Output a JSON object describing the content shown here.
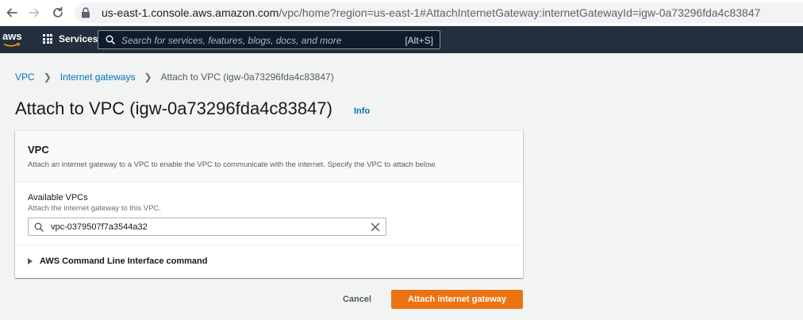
{
  "browser": {
    "url_host": "us-east-1.console.aws.amazon.com",
    "url_path": "/vpc/home?region=us-east-1#AttachInternetGateway:internetGatewayId=igw-0a73296fda4c83847",
    "icons": [
      "back-arrow-icon",
      "forward-arrow-icon",
      "reload-icon",
      "lock-icon"
    ]
  },
  "topnav": {
    "logo_text": "aws",
    "services_label": "Services",
    "search_placeholder": "Search for services, features, blogs, docs, and more",
    "search_shortcut": "[Alt+S]"
  },
  "breadcrumb": {
    "items": [
      "VPC",
      "Internet gateways",
      "Attach to VPC (igw-0a73296fda4c83847)"
    ]
  },
  "page": {
    "title": "Attach to VPC (igw-0a73296fda4c83847)",
    "info_label": "Info"
  },
  "panel": {
    "title": "VPC",
    "description": "Attach an internet gateway to a VPC to enable the VPC to communicate with the internet. Specify the VPC to attach below.",
    "field_label": "Available VPCs",
    "field_description": "Attach the internet gateway to this VPC.",
    "field_value": "vpc-0379507f7a3544a32",
    "cli_label": "AWS Command Line Interface command"
  },
  "actions": {
    "cancel_label": "Cancel",
    "attach_label": "Attach internet gateway"
  },
  "colors": {
    "nav_bg": "#232f3e",
    "link": "#0073bb",
    "primary_button": "#ec7211"
  }
}
